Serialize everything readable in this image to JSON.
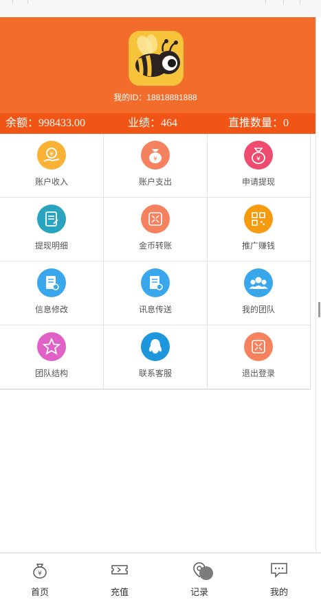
{
  "header": {
    "user_id": "我的ID：18818881888"
  },
  "stats": {
    "balance": "余额：998433.00",
    "performance": "业绩：464",
    "direct_count": "直推数量：0"
  },
  "menu": [
    {
      "label": "账户收入",
      "icon": "yuan-hand-icon",
      "color": "#f9b234"
    },
    {
      "label": "账户支出",
      "icon": "money-bag-icon",
      "color": "#f6815e"
    },
    {
      "label": "申请提现",
      "icon": "money-bag-icon",
      "color": "#ee4b6f"
    },
    {
      "label": "提现明细",
      "icon": "document-list-icon",
      "color": "#2aa3bf"
    },
    {
      "label": "金币转账",
      "icon": "transfer-frame-icon",
      "color": "#f6815e"
    },
    {
      "label": "推广赚钱",
      "icon": "qr-code-icon",
      "color": "#f69b0f"
    },
    {
      "label": "信息修改",
      "icon": "edit-document-icon",
      "color": "#3aa6ec"
    },
    {
      "label": "讯息传送",
      "icon": "message-document-icon",
      "color": "#3aa6ec"
    },
    {
      "label": "我的团队",
      "icon": "team-icon",
      "color": "#3aa6ec"
    },
    {
      "label": "团队结构",
      "icon": "star-icon",
      "color": "#e062c6"
    },
    {
      "label": "联系客服",
      "icon": "qq-penguin-icon",
      "color": "#1d96dc"
    },
    {
      "label": "退出登录",
      "icon": "exit-frame-icon",
      "color": "#f6815e"
    }
  ],
  "tabbar": [
    {
      "label": "首页",
      "icon": "home-yuan-bag-icon"
    },
    {
      "label": "充值",
      "icon": "ticket-icon"
    },
    {
      "label": "记录",
      "icon": "location-pin-icon"
    },
    {
      "label": "我的",
      "icon": "chat-bubble-icon"
    }
  ],
  "colors": {
    "header": "#f26c2c",
    "stats_bar": "#f05516"
  }
}
